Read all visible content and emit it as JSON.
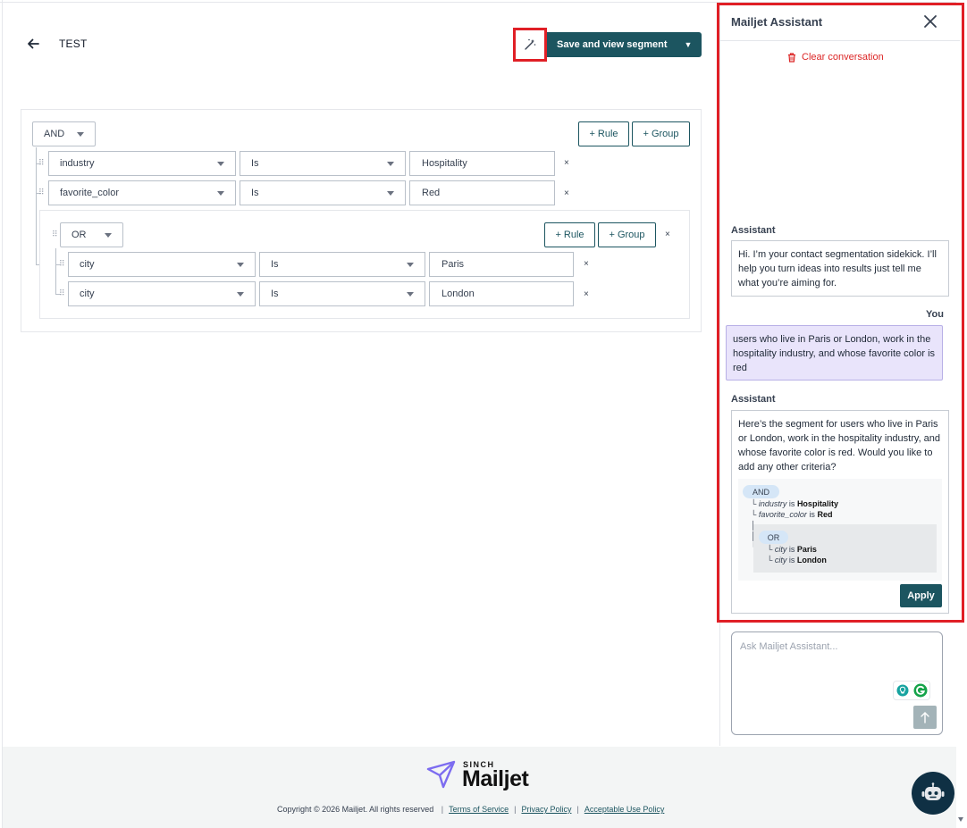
{
  "header": {
    "title": "TEST",
    "save_label": "Save and view segment"
  },
  "builder": {
    "root_logic": "AND",
    "add_rule_label": "+ Rule",
    "add_group_label": "+ Group",
    "remove_symbol": "×",
    "rules": [
      {
        "field": "industry",
        "operator": "Is",
        "value": "Hospitality"
      },
      {
        "field": "favorite_color",
        "operator": "Is",
        "value": "Red"
      }
    ],
    "group": {
      "logic": "OR",
      "rules": [
        {
          "field": "city",
          "operator": "Is",
          "value": "Paris"
        },
        {
          "field": "city",
          "operator": "Is",
          "value": "London"
        }
      ]
    }
  },
  "assistant": {
    "title": "Mailjet Assistant",
    "clear_label": "Clear conversation",
    "assistant_role": "Assistant",
    "user_role": "You",
    "messages": [
      {
        "role": "Assistant",
        "text": "Hi. I’m your contact segmentation sidekick. I’ll help you turn ideas into results just tell me what you’re aiming for."
      },
      {
        "role": "You",
        "text": "users who live in Paris or London, work in the hospitality industry, and whose favorite color is red"
      },
      {
        "role": "Assistant",
        "text": "Here’s the segment for users who live in Paris or London, work in the hospitality industry, and whose favorite color is red. Would you like to add any other criteria?"
      }
    ],
    "tree": {
      "root_logic": "AND",
      "rules": [
        {
          "field": "industry",
          "op": "is",
          "value": "Hospitality"
        },
        {
          "field": "favorite_color",
          "op": "is",
          "value": "Red"
        }
      ],
      "group_logic": "OR",
      "group_rules": [
        {
          "field": "city",
          "op": "is",
          "value": "Paris"
        },
        {
          "field": "city",
          "op": "is",
          "value": "London"
        }
      ]
    },
    "apply_label": "Apply",
    "input_placeholder": "Ask Mailjet Assistant..."
  },
  "footer": {
    "brand_top": "SINCH",
    "brand_name": "Mailjet",
    "copyright": "Copyright © 2026 Mailjet. All rights reserved",
    "links": [
      "Terms of Service",
      "Privacy Policy",
      "Acceptable Use Policy"
    ],
    "link_separator": "|"
  },
  "colors": {
    "primary": "#1c5560",
    "highlight": "#e01f26",
    "user_bubble": "#e9e4fb",
    "danger": "#dc2626"
  }
}
